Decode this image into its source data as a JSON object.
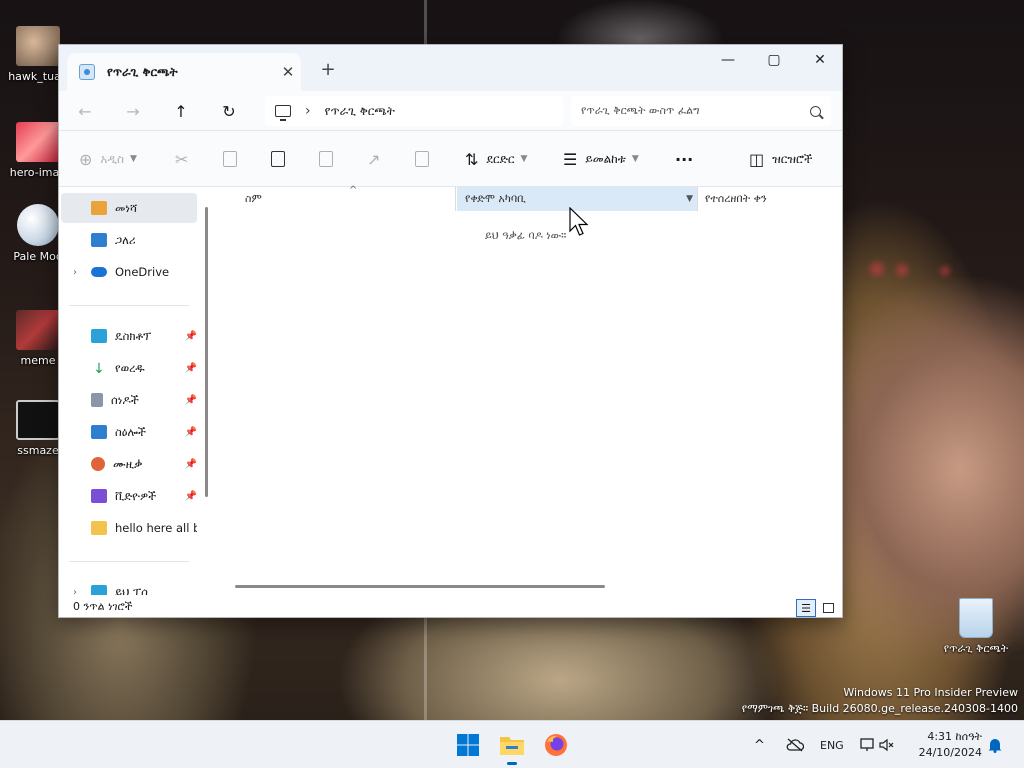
{
  "desktop": {
    "icons": [
      {
        "label": "hawk_tuah"
      },
      {
        "label": "hero-imag"
      },
      {
        "label": "Pale Moo"
      },
      {
        "label": "meme"
      },
      {
        "label": "ssmaze"
      }
    ],
    "recycle_bin_label": "የጥራጊ ቅርጫት",
    "watermark_line1": "Windows 11 Pro Insider Preview",
    "watermark_line2": "የማምገጫ ቅጅ። Build 26080.ge_release.240308-1400"
  },
  "window": {
    "tab_title": "የጥራጊ ቅርጫት",
    "tab_close": "✕",
    "new_tab": "+",
    "minimize": "—",
    "maximize": "▢",
    "close": "✕"
  },
  "nav": {
    "back": "←",
    "forward": "→",
    "up": "↑",
    "refresh": "↻",
    "breadcrumb_sep": "›",
    "breadcrumb": "የጥራጊ ቅርጫት",
    "search_placeholder": "የጥራጊ ቅርጫት ውስጥ ፈልግ"
  },
  "toolbar": {
    "new_label": "አዲስ",
    "sort_label": "ደርድር",
    "view_label": "ይመልከቱ",
    "more_label": "···",
    "details_label": "ዝርዝሮች"
  },
  "sidebar": {
    "items": [
      {
        "label": "መነሻ"
      },
      {
        "label": "ጋለሪ"
      },
      {
        "label": "OneDrive"
      },
      {
        "label": "ዴስክቶፕ"
      },
      {
        "label": "የወረዱ"
      },
      {
        "label": "ሰነዶች"
      },
      {
        "label": "ስዕሎች"
      },
      {
        "label": "ሙዚቃ"
      },
      {
        "label": "ቪድዮዎች"
      },
      {
        "label": "hello here all bro"
      },
      {
        "label": "ይህ ፒሲ"
      }
    ]
  },
  "content": {
    "columns": [
      {
        "label": "ስም"
      },
      {
        "label": "የቀድሞ አካባቢ"
      },
      {
        "label": "የተሰረዘበት ቀን"
      }
    ],
    "empty_message": "ይህ ዓቃፊ ባዶ ነው።"
  },
  "status": {
    "item_count": "0 ንጥል ነገሮች"
  },
  "taskbar": {
    "language": "ENG",
    "time": "4:31 ከሰዓት",
    "date": "24/10/2024",
    "chevron": "^"
  },
  "colors": {
    "accent": "#0067c0",
    "selection": "#d9e9f7",
    "window_bg": "#ffffff",
    "chrome_bg": "#f9fbfd"
  }
}
